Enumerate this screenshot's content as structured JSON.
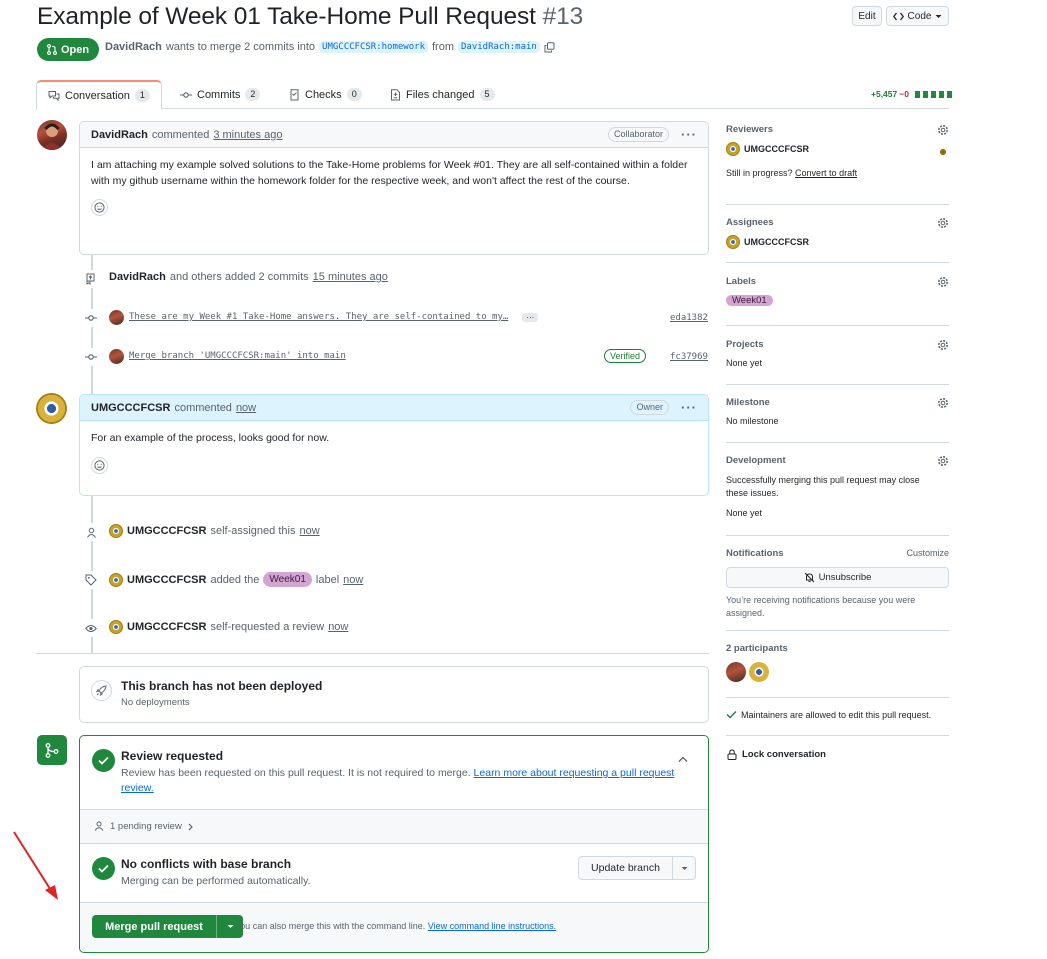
{
  "pr": {
    "title": "Example of Week 01 Take-Home Pull Request",
    "number": "#13",
    "state": "Open",
    "author": "DavidRach",
    "merge_text": "wants to merge 2 commits into",
    "base_branch": "UMGCCCFCSR:homework",
    "from_text": "from",
    "head_branch": "DavidRach:main"
  },
  "header_buttons": {
    "edit": "Edit",
    "code": "Code"
  },
  "tabs": [
    {
      "label": "Conversation",
      "count": "1"
    },
    {
      "label": "Commits",
      "count": "2"
    },
    {
      "label": "Checks",
      "count": "0"
    },
    {
      "label": "Files changed",
      "count": "5"
    }
  ],
  "diffstat": {
    "additions": "+5,457",
    "deletions": "−0"
  },
  "comment1": {
    "author": "DavidRach",
    "action": "commented",
    "time": "3 minutes ago",
    "role": "Collaborator",
    "body": "I am attaching my example solved solutions to the Take-Home problems for Week #01. They are all self-contained within a folder with my github username within the homework folder for the respective week, and won't affect the rest of the course."
  },
  "commits_event": {
    "author": "DavidRach",
    "text": "and others added 2 commits",
    "time": "15 minutes ago"
  },
  "commits": [
    {
      "message": "These are my Week #1 Take-Home answers. They are self-contained to my…",
      "more": "···",
      "sha": "eda1382",
      "verified": ""
    },
    {
      "message": "Merge branch 'UMGCCCFCSR:main' into main",
      "more": "",
      "sha": "fc37969",
      "verified": "Verified"
    }
  ],
  "comment2": {
    "author": "UMGCCCFCSR",
    "action": "commented",
    "time": "now",
    "role": "Owner",
    "body": "For an example of the process, looks good for now."
  },
  "events": [
    {
      "actor": "UMGCCCFCSR",
      "text": "self-assigned this",
      "time": "now"
    },
    {
      "actor": "UMGCCCFCSR",
      "text_before": "added the",
      "label": "Week01",
      "text_after": "label",
      "time": "now"
    },
    {
      "actor": "UMGCCCFCSR",
      "text": "self-requested a review",
      "time": "now"
    }
  ],
  "deploy": {
    "title": "This branch has not been deployed",
    "subtitle": "No deployments"
  },
  "merge": {
    "review_title": "Review requested",
    "review_text": "Review has been requested on this pull request. It is not required to merge.",
    "review_link": "Learn more about requesting a pull request review.",
    "pending": "1 pending review",
    "conflicts_title": "No conflicts with base branch",
    "conflicts_text": "Merging can be performed automatically.",
    "update_branch": "Update branch",
    "merge_button": "Merge pull request",
    "cli_text": "You can also merge this with the command line.",
    "cli_link": "View command line instructions."
  },
  "sidebar": {
    "reviewers": {
      "heading": "Reviewers",
      "name": "UMGCCCFCSR",
      "status_color": "#9a6700",
      "note": "Still in progress?",
      "convert": "Convert to draft"
    },
    "assignees": {
      "heading": "Assignees",
      "name": "UMGCCCFCSR"
    },
    "labels": {
      "heading": "Labels",
      "label": "Week01",
      "label_color": "#d4a4d3"
    },
    "projects": {
      "heading": "Projects",
      "value": "None yet"
    },
    "milestone": {
      "heading": "Milestone",
      "value": "No milestone"
    },
    "development": {
      "heading": "Development",
      "text": "Successfully merging this pull request may close these issues.",
      "value": "None yet"
    },
    "notifications": {
      "heading": "Notifications",
      "customize": "Customize",
      "button": "Unsubscribe",
      "note": "You’re receiving notifications because you were assigned."
    },
    "participants": {
      "heading": "2 participants"
    },
    "maintainers": "Maintainers are allowed to edit this pull request.",
    "lock": "Lock conversation"
  },
  "colors": {
    "accent": "#0969da",
    "success": "#1f883d",
    "border": "#d1d9e0",
    "muted": "#59636e"
  }
}
